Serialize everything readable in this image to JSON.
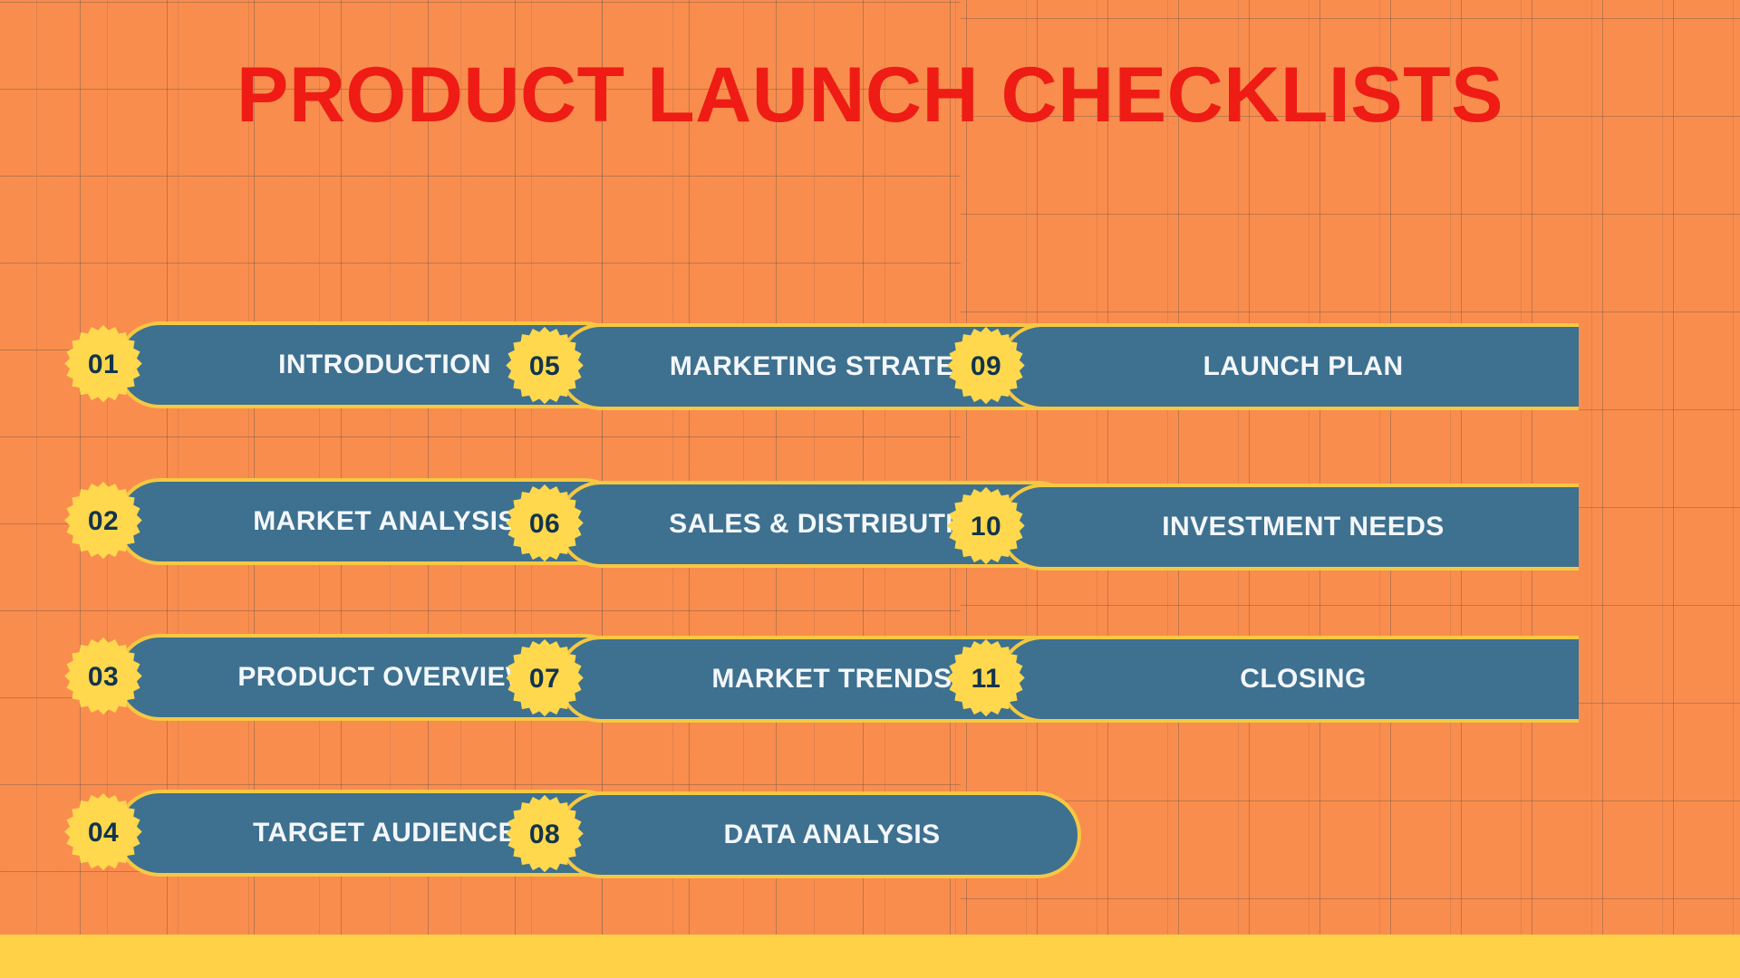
{
  "slide": {
    "title": "PRODUCT LAUNCH CHECKLISTS",
    "background_color": "#F98D4E",
    "title_color": "#EE1C15",
    "pill_color": "#3E708F",
    "pill_border_color": "#F5C842",
    "badge_color": "#FFD84D",
    "badge_text_color": "#12344D",
    "label_color": "#F3F7FB",
    "bottom_bar_color": "#FFD147"
  },
  "columns": [
    {
      "id": "column-1",
      "items": [
        {
          "number": "01",
          "label": "INTRODUCTION"
        },
        {
          "number": "02",
          "label": "MARKET ANALYSIS"
        },
        {
          "number": "03",
          "label": "PRODUCT OVERVIEW"
        },
        {
          "number": "04",
          "label": "TARGET AUDIENCE"
        }
      ]
    },
    {
      "id": "column-2",
      "items": [
        {
          "number": "05",
          "label": "MARKETING STRATEGY"
        },
        {
          "number": "06",
          "label": "SALES & DISTRIBUTION"
        },
        {
          "number": "07",
          "label": "MARKET TRENDS"
        },
        {
          "number": "08",
          "label": "DATA ANALYSIS"
        }
      ]
    },
    {
      "id": "column-3",
      "items": [
        {
          "number": "09",
          "label": "LAUNCH PLAN"
        },
        {
          "number": "10",
          "label": "INVESTMENT NEEDS"
        },
        {
          "number": "11",
          "label": "CLOSING"
        }
      ]
    }
  ]
}
